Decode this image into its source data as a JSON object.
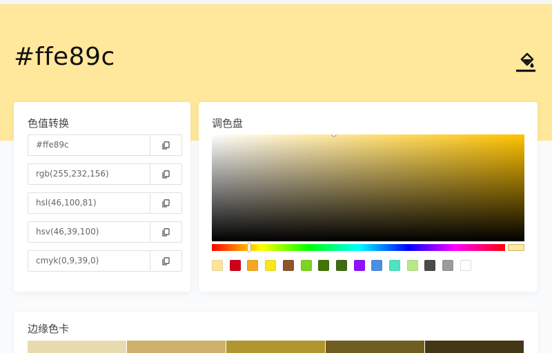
{
  "current_color": "#ffe89c",
  "hero": {
    "title": "#ffe89c",
    "icon": "fill-bucket-icon"
  },
  "converter": {
    "title": "色值转换",
    "values": [
      "#ffe89c",
      "rgb(255,232,156)",
      "hsl(46,100,81)",
      "hsv(46,39,100)",
      "cmyk(0,9,39,0)"
    ],
    "copy_icon": "copy-icon"
  },
  "palette": {
    "title": "调色盘",
    "hue": 46,
    "saturation": 0.39,
    "brightness": 1.0,
    "presets": [
      "#fbe49c",
      "#d0021b",
      "#f5a623",
      "#f8e71c",
      "#8b572a",
      "#7ed321",
      "#417505",
      "#3f6c12",
      "#9013fe",
      "#4a90e2",
      "#50e3c2",
      "#b8e986",
      "#4a4a4a",
      "#9b9b9b",
      "#ffffff"
    ]
  },
  "edge_card": {
    "title": "边缘色卡",
    "colors": [
      "#e8dcae",
      "#cdb06a",
      "#b1952f",
      "#6f5e20",
      "#423816"
    ]
  }
}
